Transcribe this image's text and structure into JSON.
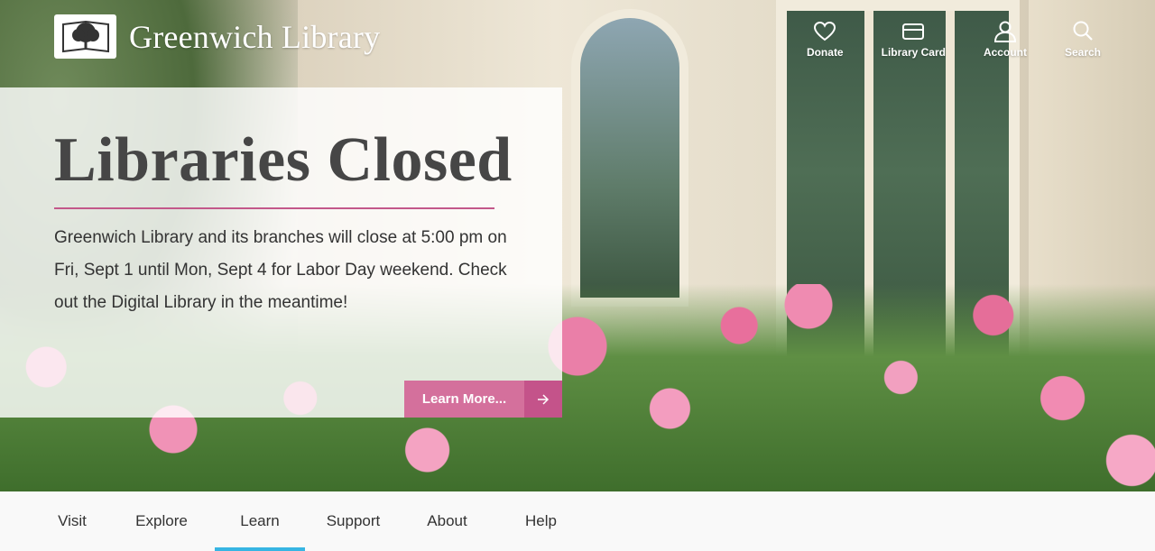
{
  "brand": {
    "name": "Greenwich Library",
    "logo_icon": "tree-book-icon"
  },
  "utility_nav": [
    {
      "label": "Donate",
      "icon": "heart-icon"
    },
    {
      "label": "Library Card",
      "icon": "card-icon"
    },
    {
      "label": "Account",
      "icon": "user-icon"
    },
    {
      "label": "Search",
      "icon": "search-icon"
    }
  ],
  "alert": {
    "title": "Libraries Closed",
    "body": "Greenwich Library and its branches will close at 5:00 pm on Fri, Sept 1 until Mon, Sept 4 for Labor Day weekend. Check out the Digital Library in the meantime!",
    "button_label": "Learn More...",
    "button_icon": "arrow-right-icon"
  },
  "main_nav": {
    "items": [
      {
        "label": "Visit"
      },
      {
        "label": "Explore"
      },
      {
        "label": "Learn"
      },
      {
        "label": "Support"
      },
      {
        "label": "About"
      },
      {
        "label": "Help"
      }
    ],
    "active": "Learn"
  },
  "colors": {
    "accent_pink": "#d4709c",
    "accent_pink_dark": "#c4538a",
    "rule_pink": "#c3588a",
    "active_tab": "#37b5e3"
  }
}
